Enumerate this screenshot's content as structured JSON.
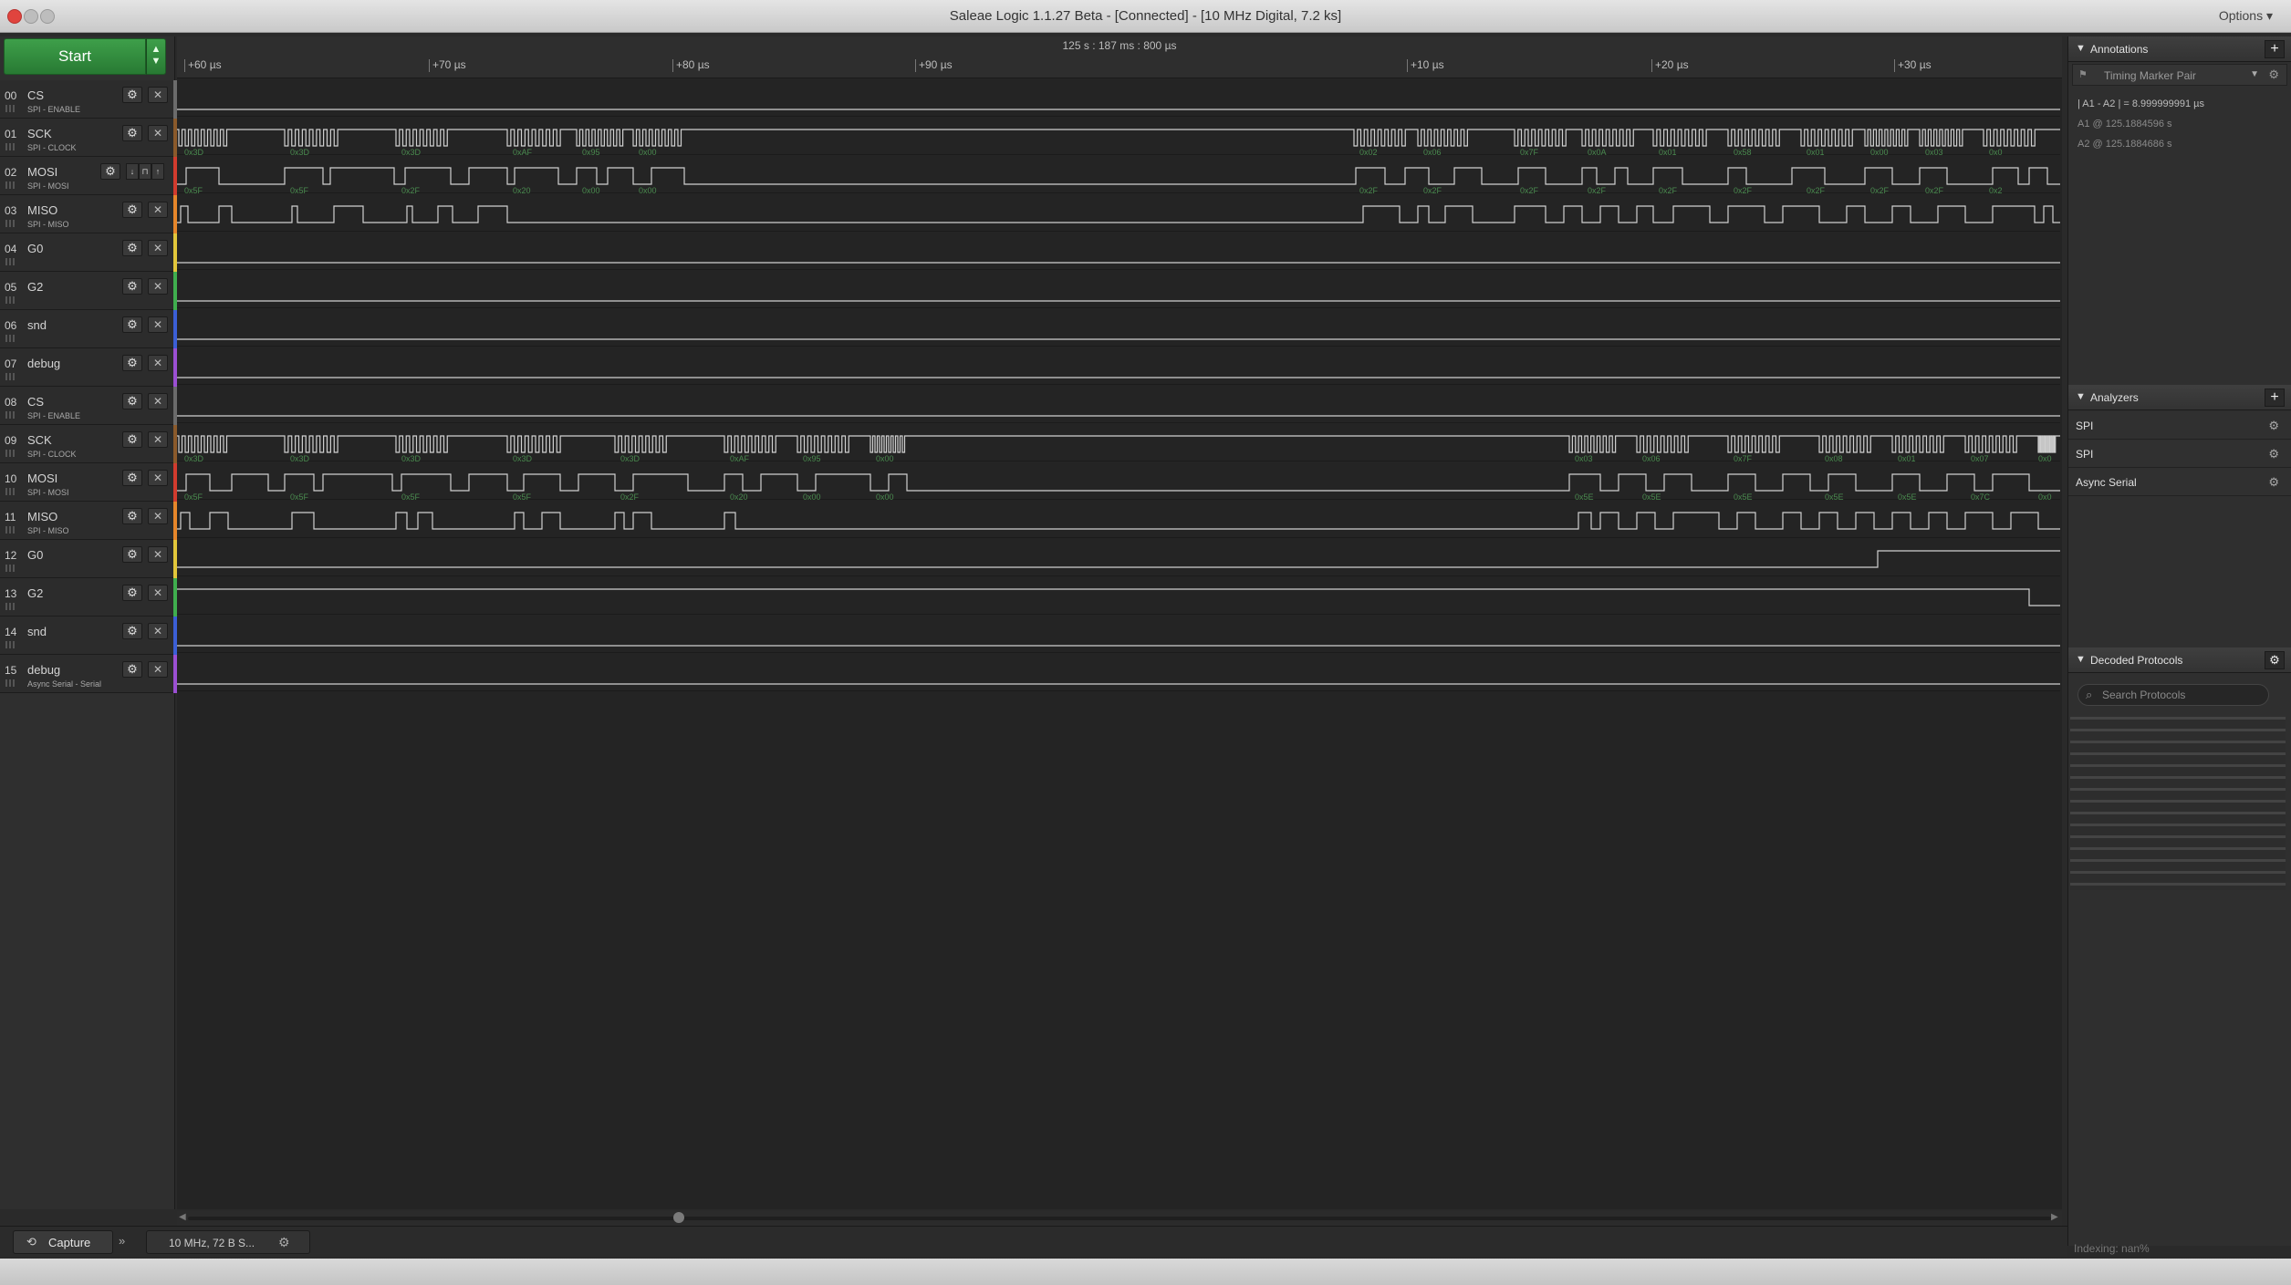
{
  "window": {
    "title": "Saleae Logic 1.1.27 Beta - [Connected] - [10 MHz Digital, 7.2 ks]",
    "options": "Options ▾"
  },
  "toolbar": {
    "start_label": "Start",
    "arrows": "▲▼"
  },
  "channels": [
    {
      "num": "00",
      "name": "CS",
      "sub": "SPI - ENABLE",
      "color": "#6b6b6b",
      "trigger": false
    },
    {
      "num": "01",
      "name": "SCK",
      "sub": "SPI - CLOCK",
      "color": "#8b5a2b",
      "trigger": false
    },
    {
      "num": "02",
      "name": "MOSI",
      "sub": "SPI - MOSI",
      "color": "#d23b2e",
      "trigger": true
    },
    {
      "num": "03",
      "name": "MISO",
      "sub": "SPI - MISO",
      "color": "#e6862a",
      "trigger": false
    },
    {
      "num": "04",
      "name": "G0",
      "sub": "",
      "color": "#e2c63a",
      "trigger": false
    },
    {
      "num": "05",
      "name": "G2",
      "sub": "",
      "color": "#3fae4e",
      "trigger": false
    },
    {
      "num": "06",
      "name": "snd",
      "sub": "",
      "color": "#3b5fd6",
      "trigger": false
    },
    {
      "num": "07",
      "name": "debug",
      "sub": "",
      "color": "#9b4fd3",
      "trigger": false
    },
    {
      "num": "08",
      "name": "CS",
      "sub": "SPI - ENABLE",
      "color": "#6b6b6b",
      "trigger": false
    },
    {
      "num": "09",
      "name": "SCK",
      "sub": "SPI - CLOCK",
      "color": "#8b5a2b",
      "trigger": false
    },
    {
      "num": "10",
      "name": "MOSI",
      "sub": "SPI - MOSI",
      "color": "#d23b2e",
      "trigger": false
    },
    {
      "num": "11",
      "name": "MISO",
      "sub": "SPI - MISO",
      "color": "#e6862a",
      "trigger": false
    },
    {
      "num": "12",
      "name": "G0",
      "sub": "",
      "color": "#e2c63a",
      "trigger": false
    },
    {
      "num": "13",
      "name": "G2",
      "sub": "",
      "color": "#3fae4e",
      "trigger": false
    },
    {
      "num": "14",
      "name": "snd",
      "sub": "",
      "color": "#3b5fd6",
      "trigger": false
    },
    {
      "num": "15",
      "name": "debug",
      "sub": "Async Serial - Serial",
      "color": "#9b4fd3",
      "trigger": false
    }
  ],
  "ruler": {
    "center": "125 s : 187 ms : 800 µs",
    "ticks": [
      "+60 µs",
      "+70 µs",
      "+80 µs",
      "+90 µs",
      "+10 µs",
      "+20 µs",
      "+30 µs"
    ]
  },
  "decodes": {
    "mosi_a": [
      "0x3D",
      "0x3D",
      "0x3D",
      "0xAF",
      "0x95",
      "0x00",
      "0x02",
      "0x06",
      "0x7F",
      "0x0A",
      "0x01",
      "0x58",
      "0x01",
      "0x00",
      "0x03",
      "0x0"
    ],
    "miso_a": [
      "0x5F",
      "0x5F",
      "0x2F",
      "0x20",
      "0x00",
      "0x00",
      "0x2F",
      "0x2F",
      "0x2F",
      "0x2F",
      "0x2F",
      "0x2F",
      "0x2F",
      "0x2F",
      "0x2F",
      "0x2"
    ],
    "mosi_b": [
      "0x3D",
      "0x3D",
      "0x3D",
      "0x3D",
      "0x3D",
      "0xAF",
      "0x95",
      "0x00",
      "0x03",
      "0x06",
      "0x7F",
      "0x08",
      "0x01",
      "0x07",
      "0x0"
    ],
    "miso_b": [
      "0x5F",
      "0x5F",
      "0x5F",
      "0x5F",
      "0x2F",
      "0x20",
      "0x00",
      "0x00",
      "0x5E",
      "0x5E",
      "0x5E",
      "0x5E",
      "0x5E",
      "0x7C",
      "0x0"
    ]
  },
  "annotations": {
    "title": "Annotations",
    "add": "+",
    "marker_label": "Timing Marker Pair",
    "delta": "| A1 - A2 | = 8.999999991 µs",
    "a1": "A1  @  125.1884596 s",
    "a2": "A2  @  125.1884686 s"
  },
  "analyzers": {
    "title": "Analyzers",
    "add": "+",
    "items": [
      "SPI",
      "SPI",
      "Async Serial"
    ]
  },
  "decoded_protocols": {
    "title": "Decoded Protocols",
    "search_placeholder": "Search Protocols"
  },
  "status": {
    "indexing": "Indexing: nan%"
  },
  "bottom": {
    "capture_label": "Capture",
    "expand": "»",
    "session_label": "10 MHz, 72 B S..."
  }
}
